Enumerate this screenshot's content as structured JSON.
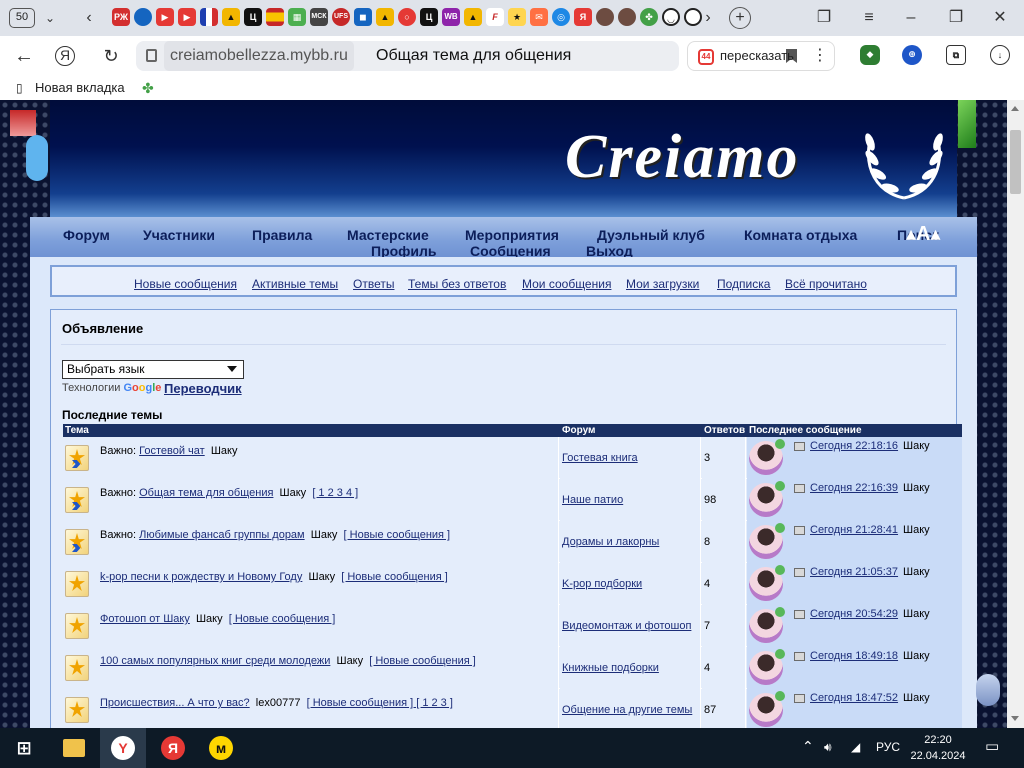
{
  "browser": {
    "tab_count": "50",
    "url_domain": "creiamobellezza.mybb.ru",
    "page_title": "Общая тема для общения",
    "retell_label": "пересказать",
    "bookmarks": [
      {
        "label": "Новая вкладка"
      }
    ]
  },
  "site": {
    "logo_text": "Creiamo",
    "nav": [
      "Форум",
      "Участники",
      "Правила",
      "Мастерские",
      "Мероприятия",
      "Дуэльный клуб",
      "Комната отдыха",
      "Поиск",
      "Профиль",
      "Сообщения",
      "Выход"
    ],
    "subnav": [
      "Новые сообщения",
      "Активные темы",
      "Ответы",
      "Темы без ответов",
      "Мои сообщения",
      "Мои загрузки",
      "Подписка",
      "Всё прочитано"
    ]
  },
  "announcement": {
    "title": "Объявление",
    "lang_select": "Выбрать язык",
    "powered_by": "Технологии",
    "google": "Google",
    "translate_link": "Переводчик",
    "latest_topics_title": "Последние темы",
    "columns": {
      "topic": "Тема",
      "forum": "Форум",
      "replies": "Ответов",
      "last_post": "Последнее сообщение"
    },
    "topics": [
      {
        "prefix": "Важно:",
        "title": "Гостевой чат",
        "author": "Шаку",
        "extra": "",
        "forum": "Гостевая книга",
        "replies": "3",
        "last_time": "Сегодня 22:18:16",
        "last_author": "Шаку"
      },
      {
        "prefix": "Важно:",
        "title": "Общая тема для общения",
        "author": "Шаку",
        "extra": "[ 1 2 3 4 ]",
        "forum": "Наше патио",
        "replies": "98",
        "last_time": "Сегодня 22:16:39",
        "last_author": "Шаку"
      },
      {
        "prefix": "Важно:",
        "title": "Любимые фансаб группы дорам",
        "author": "Шаку",
        "extra": "[ Новые сообщения ]",
        "forum": "Дорамы и лакорны",
        "replies": "8",
        "last_time": "Сегодня 21:28:41",
        "last_author": "Шаку"
      },
      {
        "prefix": "",
        "title": "k-pop песни к рождеству и Новому Году",
        "author": "Шаку",
        "extra": "[ Новые сообщения ]",
        "forum": "K-pop подборки",
        "replies": "4",
        "last_time": "Сегодня 21:05:37",
        "last_author": "Шаку"
      },
      {
        "prefix": "",
        "title": "Фотошоп от Шаку",
        "author": "Шаку",
        "extra": "[ Новые сообщения ]",
        "forum": "Видеомонтаж и фотошоп",
        "replies": "7",
        "last_time": "Сегодня 20:54:29",
        "last_author": "Шаку"
      },
      {
        "prefix": "",
        "title": "100 самых популярных книг среди молодежи",
        "author": "Шаку",
        "extra": "[ Новые сообщения ]",
        "forum": "Книжные подборки",
        "replies": "4",
        "last_time": "Сегодня 18:49:18",
        "last_author": "Шаку"
      },
      {
        "prefix": "",
        "title": "Происшествия... А что у вас?",
        "author": "lex00777",
        "extra": "[ Новые сообщения ] [ 1 2 3 ]",
        "forum": "Общение на другие темы",
        "replies": "87",
        "last_time": "Сегодня 18:47:52",
        "last_author": "Шаку"
      }
    ]
  },
  "taskbar": {
    "lang": "РУС",
    "time": "22:20",
    "date": "22.04.2024"
  },
  "colors": {
    "nav_text": "#0c1e5a",
    "link": "#1c2d78",
    "table_head": "#1a3063",
    "row_bg": "#e4edfb",
    "last_bg": "#c9dbf7"
  }
}
